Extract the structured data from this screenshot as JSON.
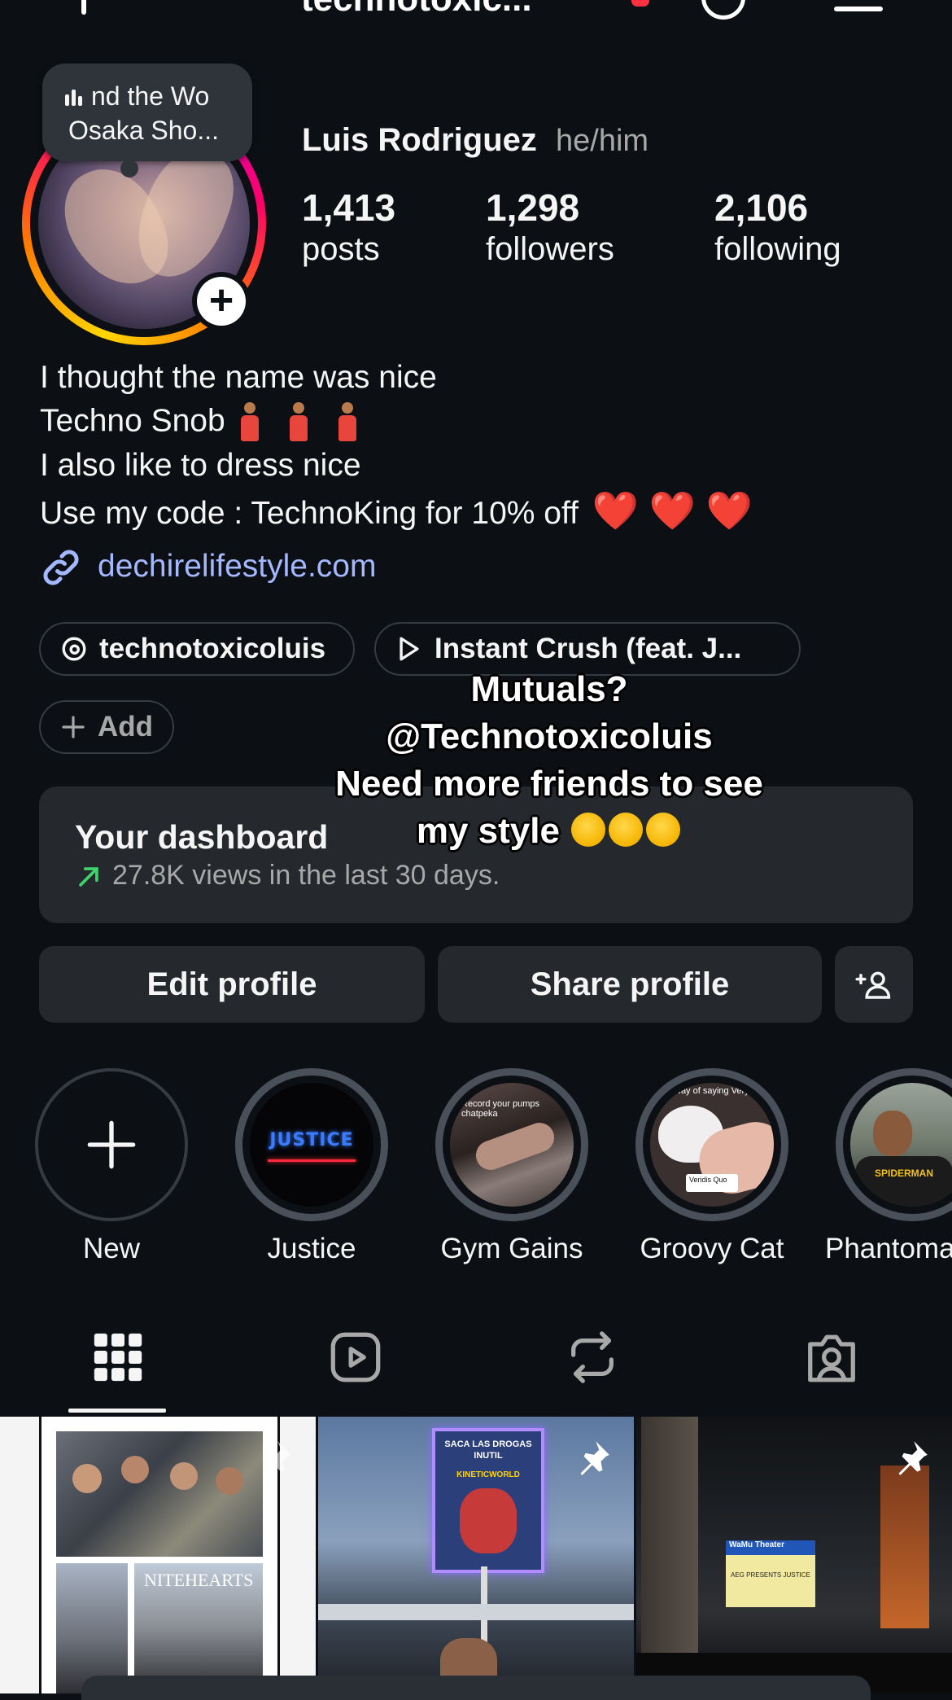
{
  "header": {
    "username": "technotoxic..."
  },
  "note": {
    "line1": "nd the Wo",
    "line2": "Osaka Sho..."
  },
  "profile": {
    "name": "Luis Rodriguez",
    "pronouns": "he/him",
    "stats": [
      {
        "value": "1,413",
        "label": "posts"
      },
      {
        "value": "1,298",
        "label": "followers"
      },
      {
        "value": "2,106",
        "label": "following"
      }
    ]
  },
  "bio": {
    "line1": "I thought the name was nice",
    "line2": "Techno Snob",
    "line3": "I also like to dress nice",
    "line4": "Use my code : TechnoKing for 10% off",
    "line4_emoji": "❤️ ❤️ ❤️",
    "link": "dechirelifestyle.com"
  },
  "chips": {
    "threads": "technotoxicoluis",
    "music": "Instant Crush (feat. J...",
    "add": "Add"
  },
  "overlay_text": {
    "line1": "Mutuals?",
    "line2": "@Technotoxicoluis",
    "line3": "Need more friends to see",
    "line4": "my style"
  },
  "dashboard": {
    "title": "Your dashboard",
    "subtitle": "27.8K views in the last 30 days.",
    "accent_color": "#3ed36b"
  },
  "buttons": {
    "edit": "Edit profile",
    "share": "Share profile"
  },
  "highlights": [
    {
      "label": "New"
    },
    {
      "label": "Justice"
    },
    {
      "label": "Gym Gains"
    },
    {
      "label": "Groovy Cat"
    },
    {
      "label": "Phantoma"
    }
  ],
  "highlight_texts": {
    "justice_logo": "JUSTICE",
    "gym_caption": "Record your pumps chatpeka",
    "cat_caption": "way of saying Very",
    "cat_music": "Veridis Quo",
    "phantom_text": "SPIDERMAN"
  },
  "tabs": [
    "grid-icon",
    "reels-icon",
    "reposts-icon",
    "tagged-icon"
  ],
  "posts": {
    "post2_sign_line1": "SACA LAS DROGAS",
    "post2_sign_line2": "INUTIL",
    "post2_sign_line3": "KINETICWORLD",
    "post1_sign": "NITEHEARTS",
    "post3_marquee_title": "WaMu Theater",
    "post3_marquee_line": "AEG PRESENTS JUSTICE"
  },
  "colors": {
    "background": "#0c1014",
    "card": "#25292e",
    "link": "#a4b8ff",
    "muted": "#a8a8a8"
  }
}
